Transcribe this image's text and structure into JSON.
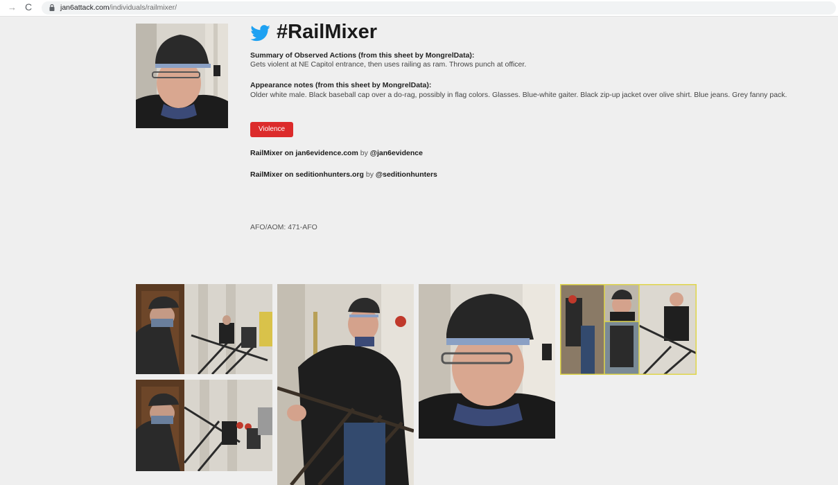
{
  "browser": {
    "url_domain": "jan6attack.com",
    "url_path": "/individuals/railmixer/",
    "forward_glyph": "→",
    "reload_glyph": "C"
  },
  "profile": {
    "title": "#RailMixer",
    "summary_heading": "Summary of Observed Actions (from this sheet by MongrelData):",
    "summary_text": "Gets violent at NE Capitol entrance, then uses railing as ram. Throws punch at officer.",
    "appearance_heading": "Appearance notes (from this sheet by MongrelData):",
    "appearance_text": "Older white male. Black baseball cap over a do-rag, possibly in flag colors. Glasses. Blue-white gaiter. Black zip-up jacket over olive shirt. Blue jeans. Grey fanny pack.",
    "tag_label": "Violence",
    "afo_text": "AFO/AOM: 471-AFO"
  },
  "links": [
    {
      "link_text": "RailMixer on jan6evidence.com",
      "by_text": " by ",
      "handle": "@jan6evidence"
    },
    {
      "link_text": "RailMixer on seditionhunters.org",
      "by_text": " by ",
      "handle": "@seditionhunters"
    }
  ],
  "colors": {
    "accent_red": "#dc2b2b",
    "twitter_blue": "#1da1f2",
    "collage_border": "#e0d64a"
  },
  "icons": {
    "bird": "twitter-bird-icon",
    "lock": "lock-icon"
  }
}
